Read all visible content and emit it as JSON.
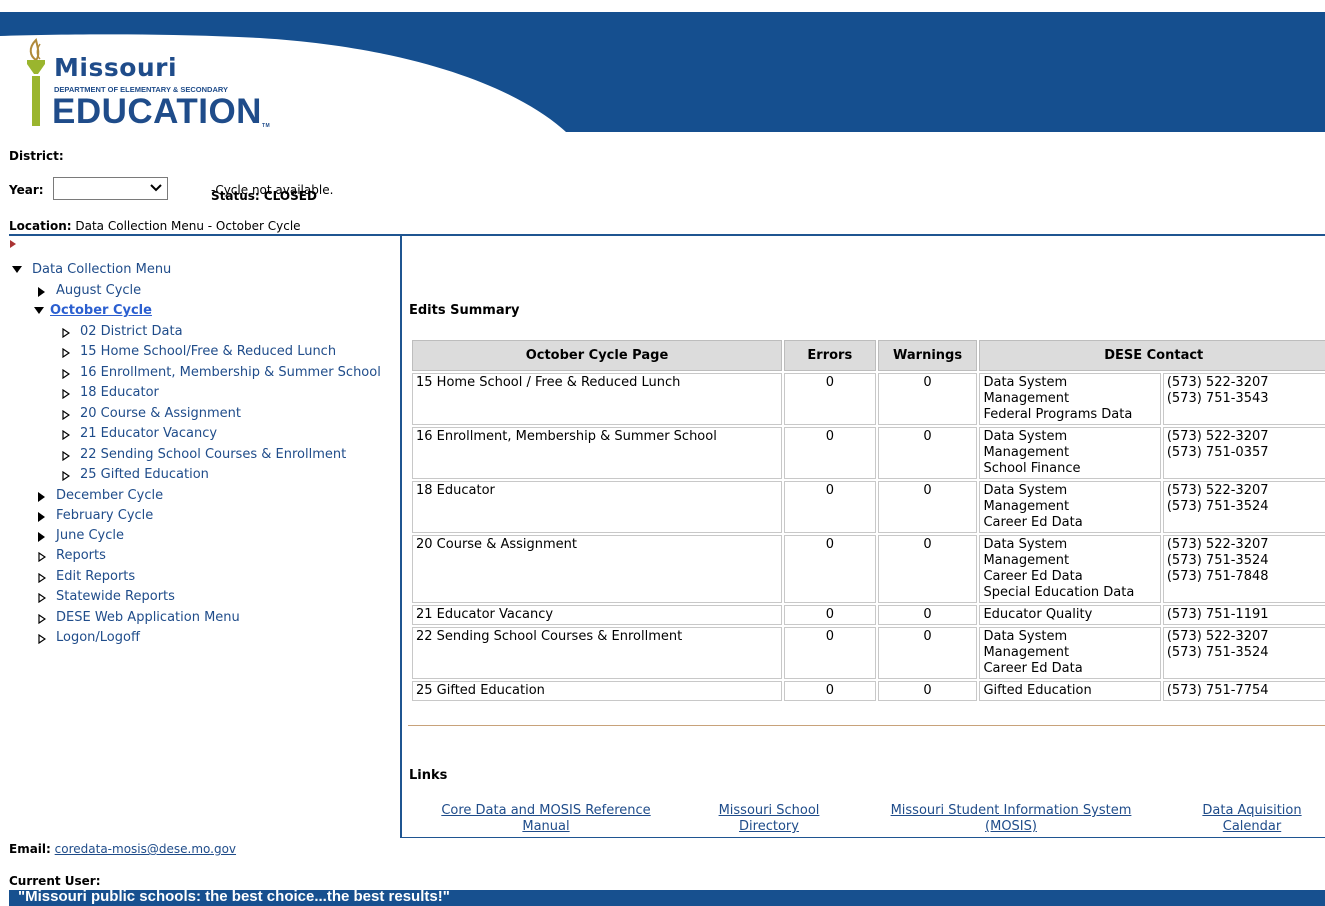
{
  "header": {
    "logo_missouri": "Missouri",
    "logo_dept": "DEPARTMENT OF ELEMENTARY & SECONDARY",
    "logo_education": "EDUCATION",
    "logo_tm": "TM",
    "brand_color": "#154f8f"
  },
  "filters": {
    "district_label": "District:",
    "year_label": "Year:",
    "year_value": "",
    "status_label": "Status: CLOSED",
    "status_text": "-Cycle not available."
  },
  "location": {
    "label": "Location:",
    "path": "Data Collection Menu - October Cycle"
  },
  "nav": {
    "root": "Data Collection Menu",
    "items": [
      {
        "label": "August Cycle"
      },
      {
        "label": "October Cycle"
      },
      {
        "label": "02 District Data"
      },
      {
        "label": "15 Home School/Free & Reduced Lunch"
      },
      {
        "label": "16 Enrollment, Membership & Summer School"
      },
      {
        "label": "18 Educator"
      },
      {
        "label": "20 Course & Assignment"
      },
      {
        "label": "21 Educator Vacancy"
      },
      {
        "label": "22 Sending School Courses & Enrollment"
      },
      {
        "label": "25 Gifted Education"
      },
      {
        "label": "December Cycle"
      },
      {
        "label": "February Cycle"
      },
      {
        "label": "June Cycle"
      },
      {
        "label": "Reports"
      },
      {
        "label": "Edit Reports"
      },
      {
        "label": "Statewide Reports"
      },
      {
        "label": "DESE Web Application Menu"
      },
      {
        "label": "Logon/Logoff"
      }
    ]
  },
  "summary": {
    "title": "Edits Summary",
    "headers": {
      "page": "October Cycle Page",
      "errors": "Errors",
      "warnings": "Warnings",
      "contact": "DESE Contact"
    },
    "rows": [
      {
        "page": "15 Home School / Free & Reduced Lunch",
        "errors": "0",
        "warnings": "0",
        "contacts": [
          "Data System",
          "Management",
          "Federal Programs Data"
        ],
        "phones": [
          "(573) 522-3207",
          "(573) 751-3543"
        ]
      },
      {
        "page": "16 Enrollment, Membership & Summer School",
        "errors": "0",
        "warnings": "0",
        "contacts": [
          "Data System",
          "Management",
          "School Finance"
        ],
        "phones": [
          "(573) 522-3207",
          "(573) 751-0357"
        ]
      },
      {
        "page": "18 Educator",
        "errors": "0",
        "warnings": "0",
        "contacts": [
          "Data System",
          "Management",
          "Career Ed Data"
        ],
        "phones": [
          "(573) 522-3207",
          "(573) 751-3524"
        ]
      },
      {
        "page": "20 Course & Assignment",
        "errors": "0",
        "warnings": "0",
        "contacts": [
          "Data System",
          "Management",
          "Career Ed Data",
          "Special Education Data"
        ],
        "phones": [
          "(573) 522-3207",
          "(573) 751-3524",
          "(573) 751-7848"
        ]
      },
      {
        "page": "21 Educator Vacancy",
        "errors": "0",
        "warnings": "0",
        "contacts": [
          "Educator Quality"
        ],
        "phones": [
          "(573) 751-1191"
        ]
      },
      {
        "page": "22 Sending School Courses & Enrollment",
        "errors": "0",
        "warnings": "0",
        "contacts": [
          "Data System",
          "Management",
          "Career Ed Data"
        ],
        "phones": [
          "(573) 522-3207",
          "(573) 751-3524"
        ]
      },
      {
        "page": "25 Gifted Education",
        "errors": "0",
        "warnings": "0",
        "contacts": [
          "Gifted Education"
        ],
        "phones": [
          "(573) 751-7754"
        ]
      }
    ]
  },
  "links": {
    "title": "Links",
    "items": [
      {
        "line1": "Core Data and MOSIS Reference",
        "line2": "Manual"
      },
      {
        "line1": "Missouri School",
        "line2": "Directory"
      },
      {
        "line1": "Missouri Student Information System",
        "line2": "(MOSIS)"
      },
      {
        "line1": "Data Aquisition",
        "line2": "Calendar"
      }
    ]
  },
  "footer": {
    "email_label": "Email:",
    "email": "coredata-mosis@dese.mo.gov",
    "current_user_label": "Current User:",
    "slogan": "\"Missouri public schools: the best choice...the best results!\""
  }
}
